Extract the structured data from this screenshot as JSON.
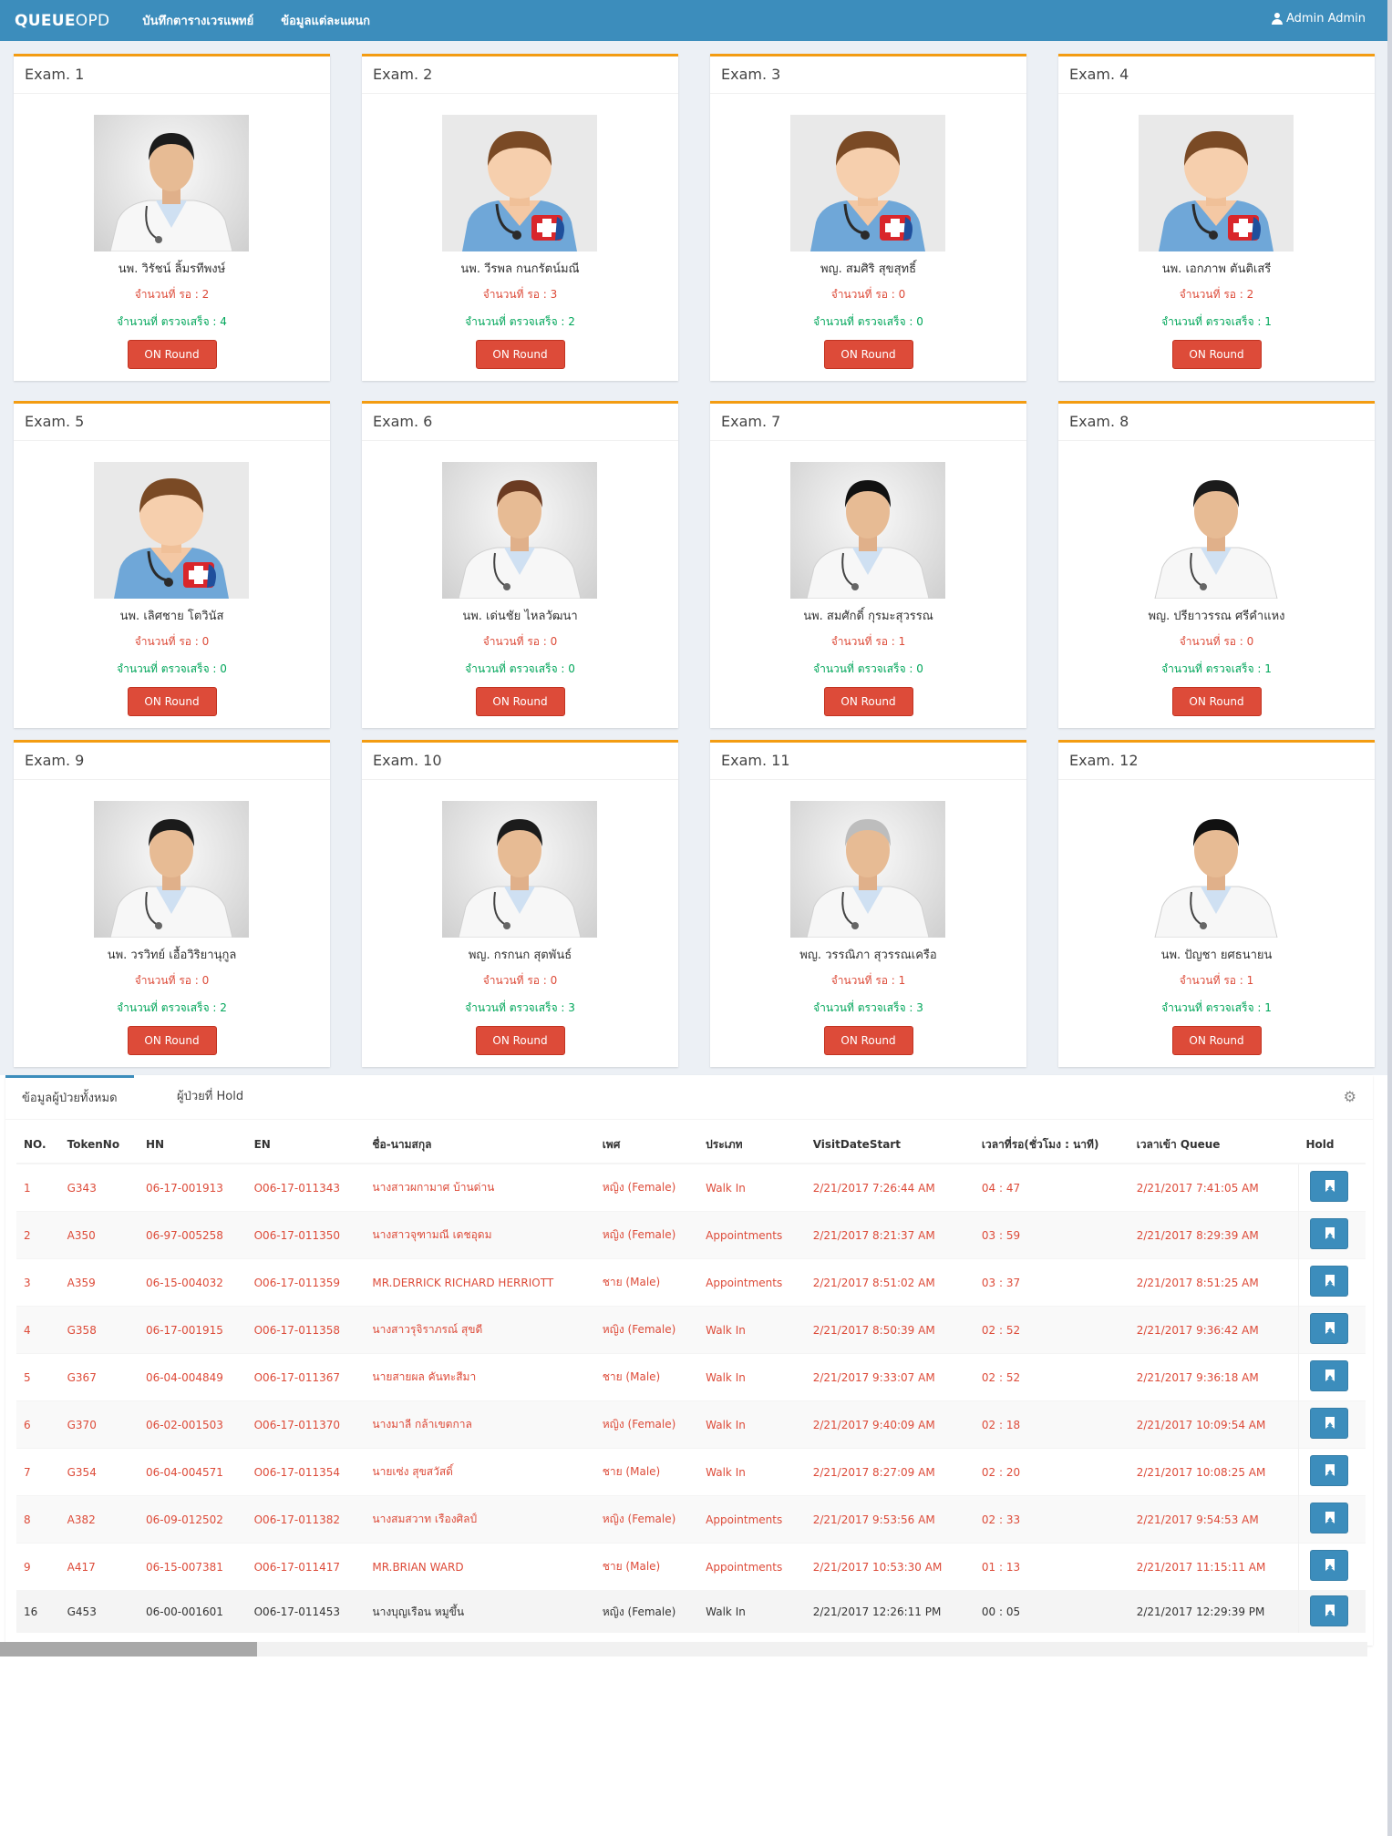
{
  "navbar": {
    "brand_bold": "QUEUE",
    "brand_rest": "OPD",
    "links": [
      "บันทึกตารางเวรแพทย์",
      "ข้อมูลแต่ละแผนก"
    ],
    "user": "Admin Admin"
  },
  "labels": {
    "wait_prefix": "จำนวนที่ รอ : ",
    "done_prefix": "จำนวนที่ ตรวจเสร็จ : ",
    "button": "ON Round"
  },
  "rooms": [
    {
      "exam": "Exam. 1",
      "doctor": "นพ. วิรัชน์ ลิ้มรทีพงษ์",
      "waiting": "2",
      "done": "4",
      "photo": "doctor-photo"
    },
    {
      "exam": "Exam. 2",
      "doctor": "นพ. วีรพล กนกรัตน์มณี",
      "waiting": "3",
      "done": "2",
      "photo": "doctor-avatar"
    },
    {
      "exam": "Exam. 3",
      "doctor": "พญ. สมศิริ สุขสุทธิ์",
      "waiting": "0",
      "done": "0",
      "photo": "doctor-avatar"
    },
    {
      "exam": "Exam. 4",
      "doctor": "นพ. เอกภาพ ตันติเสรี",
      "waiting": "2",
      "done": "1",
      "photo": "doctor-avatar"
    },
    {
      "exam": "Exam. 5",
      "doctor": "นพ. เลิศชาย โตวินัส",
      "waiting": "0",
      "done": "0",
      "photo": "doctor-avatar"
    },
    {
      "exam": "Exam. 6",
      "doctor": "นพ. เด่นชัย ไหลวัฒนา",
      "waiting": "0",
      "done": "0",
      "photo": "doctor-photo"
    },
    {
      "exam": "Exam. 7",
      "doctor": "นพ. สมศักดิ์ กุรมะสุวรรณ",
      "waiting": "1",
      "done": "0",
      "photo": "doctor-photo"
    },
    {
      "exam": "Exam. 8",
      "doctor": "พญ. ปรียาวรรณ ศรีคำแหง",
      "waiting": "0",
      "done": "1",
      "photo": "doctor-photo"
    },
    {
      "exam": "Exam. 9",
      "doctor": "นพ. วรวิทย์ เอื้อวิริยานุกูล",
      "waiting": "0",
      "done": "2",
      "photo": "doctor-photo"
    },
    {
      "exam": "Exam. 10",
      "doctor": "พญ. กรกนก สุตพันธ์",
      "waiting": "0",
      "done": "3",
      "photo": "doctor-photo"
    },
    {
      "exam": "Exam. 11",
      "doctor": "พญ. วรรณิภา สุวรรณเครือ",
      "waiting": "1",
      "done": "3",
      "photo": "doctor-photo"
    },
    {
      "exam": "Exam. 12",
      "doctor": "นพ. ปัญชา ยศธนายน",
      "waiting": "1",
      "done": "1",
      "photo": "doctor-photo"
    }
  ],
  "tabs": [
    "ข้อมูลผู้ป่วยทั้งหมด",
    "ผู้ป่วยที่ Hold"
  ],
  "table": {
    "headers": [
      "NO.",
      "TokenNo",
      "HN",
      "EN",
      "ชื่อ-นามสกุล",
      "เพศ",
      "ประเภท",
      "VisitDateStart",
      "เวลาที่รอ(ชั่วโมง : นาที)",
      "เวลาเข้า Queue",
      "Hold"
    ],
    "rows": [
      [
        "1",
        "G343",
        "06-17-001913",
        "O06-17-011343",
        "นางสาวผกามาศ บ้านด่าน",
        "หญิง (Female)",
        "Walk In",
        "2/21/2017 7:26:44 AM",
        "04 : 47",
        "2/21/2017 7:41:05 AM"
      ],
      [
        "2",
        "A350",
        "06-97-005258",
        "O06-17-011350",
        "นางสาวจุฑามณี เดชอุดม",
        "หญิง (Female)",
        "Appointments",
        "2/21/2017 8:21:37 AM",
        "03 : 59",
        "2/21/2017 8:29:39 AM"
      ],
      [
        "3",
        "A359",
        "06-15-004032",
        "O06-17-011359",
        "MR.DERRICK RICHARD HERRIOTT",
        "ชาย (Male)",
        "Appointments",
        "2/21/2017 8:51:02 AM",
        "03 : 37",
        "2/21/2017 8:51:25 AM"
      ],
      [
        "4",
        "G358",
        "06-17-001915",
        "O06-17-011358",
        "นางสาวรุจิราภรณ์ สุขดี",
        "หญิง (Female)",
        "Walk In",
        "2/21/2017 8:50:39 AM",
        "02 : 52",
        "2/21/2017 9:36:42 AM"
      ],
      [
        "5",
        "G367",
        "06-04-004849",
        "O06-17-011367",
        "นายสายผล คันทะสีมา",
        "ชาย (Male)",
        "Walk In",
        "2/21/2017 9:33:07 AM",
        "02 : 52",
        "2/21/2017 9:36:18 AM"
      ],
      [
        "6",
        "G370",
        "06-02-001503",
        "O06-17-011370",
        "นางมาลี กล้าเขตกาล",
        "หญิง (Female)",
        "Walk In",
        "2/21/2017 9:40:09 AM",
        "02 : 18",
        "2/21/2017 10:09:54 AM"
      ],
      [
        "7",
        "G354",
        "06-04-004571",
        "O06-17-011354",
        "นายเซ่ง สุขสวัสดิ์",
        "ชาย (Male)",
        "Walk In",
        "2/21/2017 8:27:09 AM",
        "02 : 20",
        "2/21/2017 10:08:25 AM"
      ],
      [
        "8",
        "A382",
        "06-09-012502",
        "O06-17-011382",
        "นางสมสวาท เรืองศิลป์",
        "หญิง (Female)",
        "Appointments",
        "2/21/2017 9:53:56 AM",
        "02 : 33",
        "2/21/2017 9:54:53 AM"
      ],
      [
        "9",
        "A417",
        "06-15-007381",
        "O06-17-011417",
        "MR.BRIAN WARD",
        "ชาย (Male)",
        "Appointments",
        "2/21/2017 10:53:30 AM",
        "01 : 13",
        "2/21/2017 11:15:11 AM"
      ],
      [
        "16",
        "G453",
        "06-00-001601",
        "O06-17-011453",
        "นางบุญเรือน หมูขึ้น",
        "หญิง (Female)",
        "Walk In",
        "2/21/2017 12:26:11 PM",
        "00 : 05",
        "2/21/2017 12:29:39 PM"
      ]
    ]
  },
  "colors": {
    "navbar": "#3c8dbc",
    "card_top_border": "#f39c12",
    "waiting_text": "#dd4b39",
    "done_text": "#00a65a",
    "round_button": "#dd4b39",
    "hold_button": "#3c8dbc"
  }
}
